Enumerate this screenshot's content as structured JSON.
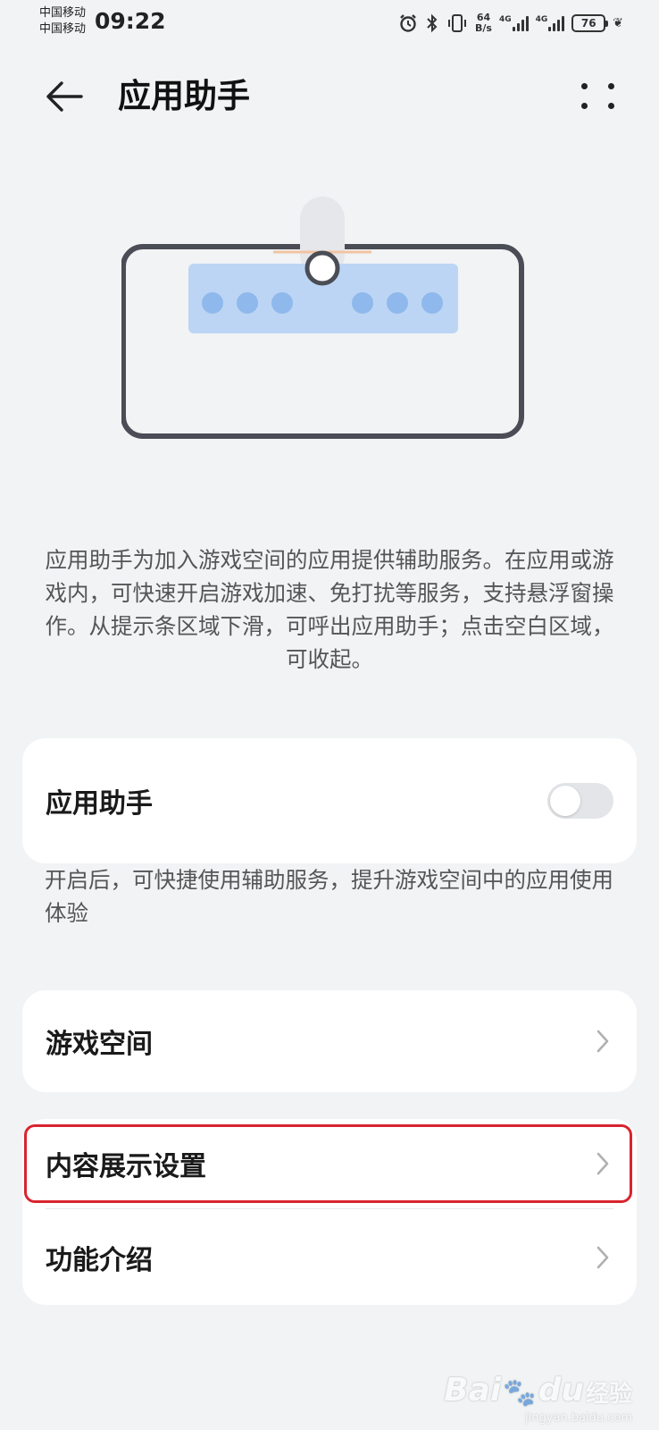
{
  "status_bar": {
    "carrier_1": "中国移动",
    "carrier_2": "中国移动",
    "time": "09:22",
    "net_speed_value": "64",
    "net_speed_unit": "B/s",
    "signal_1_label": "4G",
    "signal_2_label": "4G",
    "battery": "76",
    "icons": [
      "alarm-icon",
      "bluetooth-icon",
      "vibrate-icon",
      "signal-icon",
      "battery-icon",
      "leaf-icon"
    ]
  },
  "header": {
    "title": "应用助手",
    "back_icon": "arrow-left-icon",
    "more_icon": "more-dots-icon"
  },
  "illustration": {
    "colors": {
      "frame": "#4a4d55",
      "panel": "#b9d3f3",
      "dot": "#8db8ec",
      "handle": "#e3e5e8",
      "line": "#f0c4a4"
    }
  },
  "description": "应用助手为加入游戏空间的应用提供辅助服务。在应用或游戏内，可快速开启游戏加速、免打扰等服务，支持悬浮窗操作。从提示条区域下滑，可呼出应用助手；点击空白区域，可收起。",
  "assistant_card": {
    "label": "应用助手",
    "toggle_on": false
  },
  "assistant_hint": "开启后，可快捷使用辅助服务，提升游戏空间中的应用使用体验",
  "menu": {
    "game_space": "游戏空间",
    "content_display": "内容展示设置",
    "feature_intro": "功能介绍"
  },
  "colors": {
    "background": "#f1f3f5",
    "card": "#ffffff",
    "highlight": "#d9242f",
    "toggle_off": "#e3e5e8"
  },
  "watermark": {
    "brand": "Bai",
    "brand_suffix": "du",
    "cn": "经验",
    "sub": "jingyan.baidu.com"
  }
}
